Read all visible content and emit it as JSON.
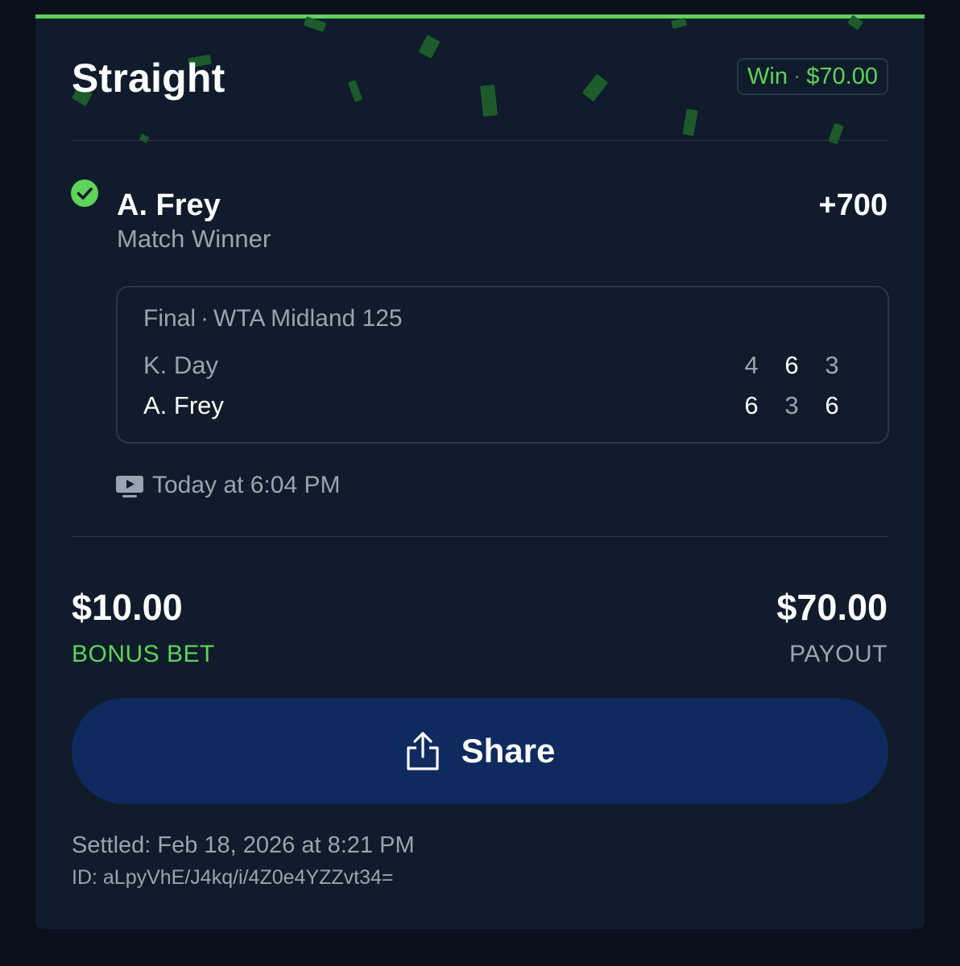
{
  "bet": {
    "type": "Straight",
    "result_label": "Win",
    "result_separator": "·",
    "result_amount": "$70.00"
  },
  "selection": {
    "status_icon": "check-circle-icon",
    "name": "A. Frey",
    "odds": "+700",
    "market": "Match Winner"
  },
  "scoreboard": {
    "status": "Final",
    "separator": "·",
    "tournament": "WTA Midland 125",
    "players": [
      {
        "name": "K. Day",
        "sets": [
          "4",
          "6",
          "3"
        ]
      },
      {
        "name": "A. Frey",
        "sets": [
          "6",
          "3",
          "6"
        ]
      }
    ]
  },
  "event": {
    "icon": "tv-icon",
    "time": "Today at 6:04 PM"
  },
  "summary": {
    "stake": "$10.00",
    "stake_label": "BONUS BET",
    "payout": "$70.00",
    "payout_label": "PAYOUT"
  },
  "share": {
    "label": "Share",
    "icon": "share-icon"
  },
  "footer": {
    "settled": "Settled: Feb 18, 2026 at 8:21 PM",
    "id": "ID: aLpyVhE/J4kq/i/4Z0e4YZZvt34="
  },
  "colors": {
    "background": "#08111c",
    "card": "#101c2b",
    "accent_green": "#5fd35a",
    "share_button": "#0f2a5e",
    "muted_text": "#9aa4b1"
  }
}
